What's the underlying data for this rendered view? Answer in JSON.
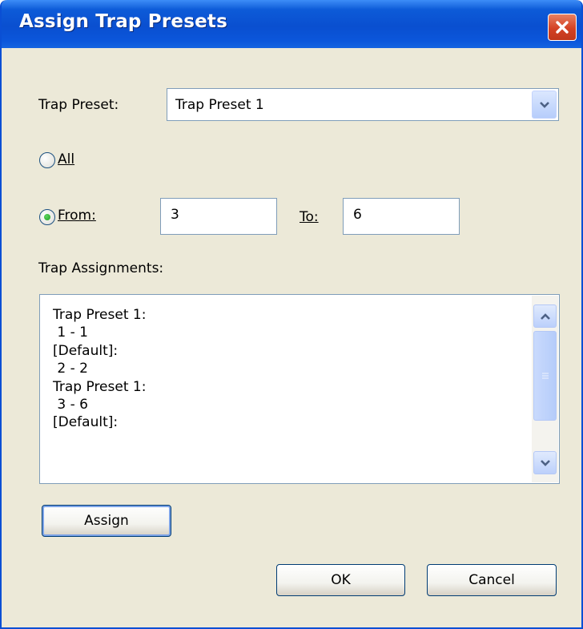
{
  "window": {
    "title": "Assign Trap Presets",
    "close_icon": "close-icon"
  },
  "trap_preset": {
    "label": "Trap Preset:",
    "selected": "Trap Preset 1"
  },
  "range": {
    "all": {
      "label": "All",
      "checked": false
    },
    "from": {
      "label": "From:",
      "checked": true,
      "value": "3"
    },
    "to": {
      "label": "To:",
      "value": "6"
    }
  },
  "assignments": {
    "label": "Trap Assignments:",
    "lines": [
      "Trap Preset 1:",
      " 1 - 1",
      "[Default]:",
      " 2 - 2",
      "Trap Preset 1:",
      " 3 - 6",
      "[Default]:"
    ]
  },
  "buttons": {
    "assign": "Assign",
    "ok": "OK",
    "cancel": "Cancel"
  },
  "colors": {
    "titlebar": "#0a4fd0",
    "dialog_bg": "#ece9d8",
    "close": "#d44224"
  }
}
